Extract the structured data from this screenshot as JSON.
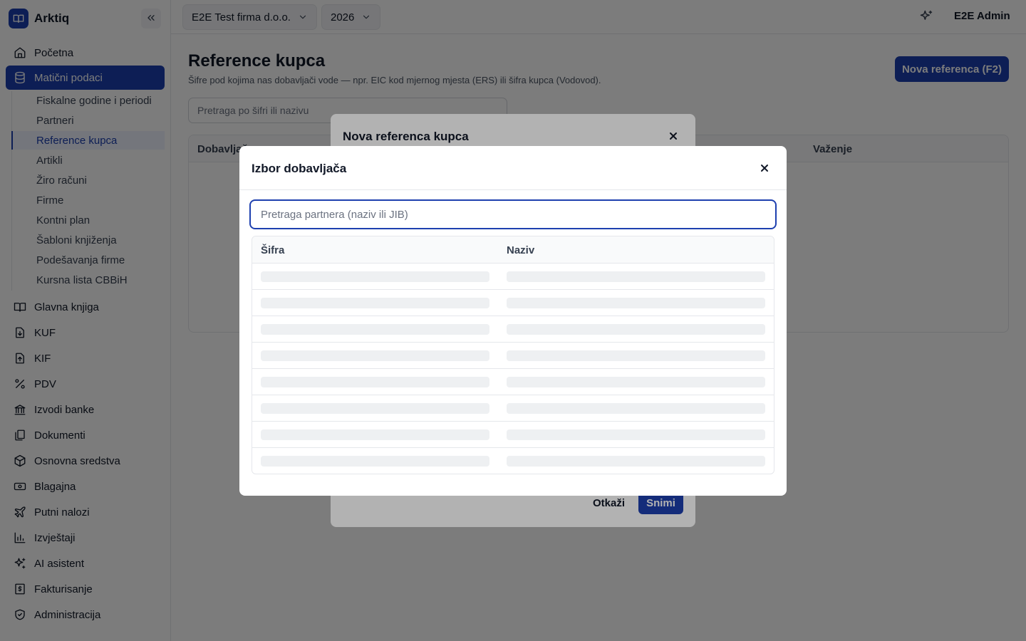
{
  "app": {
    "name": "Arktiq"
  },
  "sidebar": {
    "items": [
      {
        "label": "Početna",
        "icon": "home-icon"
      },
      {
        "label": "Matični podaci",
        "icon": "database-icon",
        "active": true
      },
      {
        "label": "Glavna knjiga",
        "icon": "book-icon"
      },
      {
        "label": "KUF",
        "icon": "file-import-icon"
      },
      {
        "label": "KIF",
        "icon": "file-export-icon"
      },
      {
        "label": "PDV",
        "icon": "percent-icon"
      },
      {
        "label": "Izvodi banke",
        "icon": "bank-icon"
      },
      {
        "label": "Dokumenti",
        "icon": "documents-icon"
      },
      {
        "label": "Osnovna sredstva",
        "icon": "package-icon"
      },
      {
        "label": "Blagajna",
        "icon": "cash-icon"
      },
      {
        "label": "Putni nalozi",
        "icon": "plane-icon"
      },
      {
        "label": "Izvještaji",
        "icon": "bar-chart-icon"
      },
      {
        "label": "AI asistent",
        "icon": "sparkles-icon"
      },
      {
        "label": "Fakturisanje",
        "icon": "invoice-icon"
      },
      {
        "label": "Administracija",
        "icon": "shield-icon"
      }
    ],
    "subitems": [
      {
        "label": "Fiskalne godine i periodi"
      },
      {
        "label": "Partneri"
      },
      {
        "label": "Reference kupca",
        "active": true
      },
      {
        "label": "Artikli"
      },
      {
        "label": "Žiro računi"
      },
      {
        "label": "Firme"
      },
      {
        "label": "Kontni plan"
      },
      {
        "label": "Šabloni knjiženja"
      },
      {
        "label": "Podešavanja firme"
      },
      {
        "label": "Kursna lista CBBiH"
      }
    ]
  },
  "topbar": {
    "company": "E2E Test firma d.o.o.",
    "year": "2026",
    "user": "E2E Admin"
  },
  "page": {
    "title": "Reference kupca",
    "subtitle": "Šifre pod kojima nas dobavljači vode — npr. EIC kod mjernog mjesta (ERS) ili šifra kupca (Vodovod).",
    "new_button": "Nova referenca (F2)",
    "search_placeholder": "Pretraga po šifri ili nazivu",
    "table_headers": {
      "col1": "Dobavljač",
      "col2": "Važenje"
    }
  },
  "modal_back": {
    "title": "Nova referenca kupca",
    "close": "×",
    "cancel": "Otkaži",
    "save": "Snimi"
  },
  "modal": {
    "title": "Izbor dobavljača",
    "close": "×",
    "search_placeholder": "Pretraga partnera (naziv ili JIB)",
    "columns": {
      "code": "Šifra",
      "name": "Naziv"
    },
    "loading_rows": 8
  },
  "colors": {
    "accent": "#1e40af",
    "border": "#e5e7eb",
    "skeleton": "#eef0f2"
  }
}
